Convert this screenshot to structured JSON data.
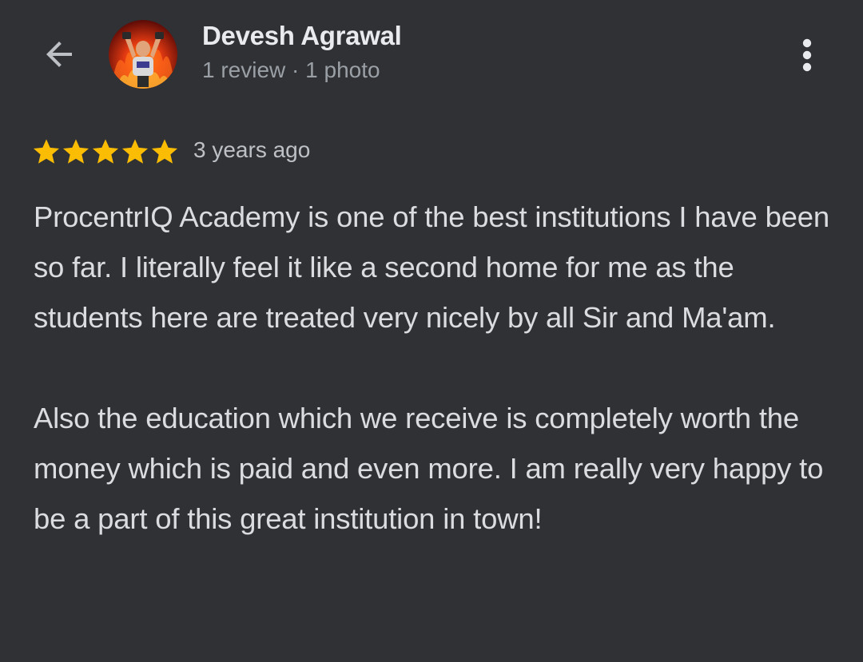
{
  "header": {
    "back_icon": "arrow-left-icon",
    "author_name": "Devesh Agrawal",
    "author_meta": "1 review · 1 photo",
    "avatar_icon": "profile-photo",
    "more_icon": "more-vert-icon"
  },
  "review": {
    "rating": 5,
    "rating_max": 5,
    "star_color": "#fbbc04",
    "time": "3 years ago",
    "paragraphs": [
      "ProcentrIQ Academy is one of the best institutions I have been so far. I literally feel it like a second home for me as the students here are treated very nicely by all Sir and Ma'am.",
      "Also the education which we receive is completely worth the money which is paid and even more. I am really very happy to be a part of this great institution in town!"
    ]
  },
  "colors": {
    "background": "#303134",
    "primary_text": "#e8eaed",
    "secondary_text": "#9aa0a6",
    "body_text": "#dadce0"
  }
}
